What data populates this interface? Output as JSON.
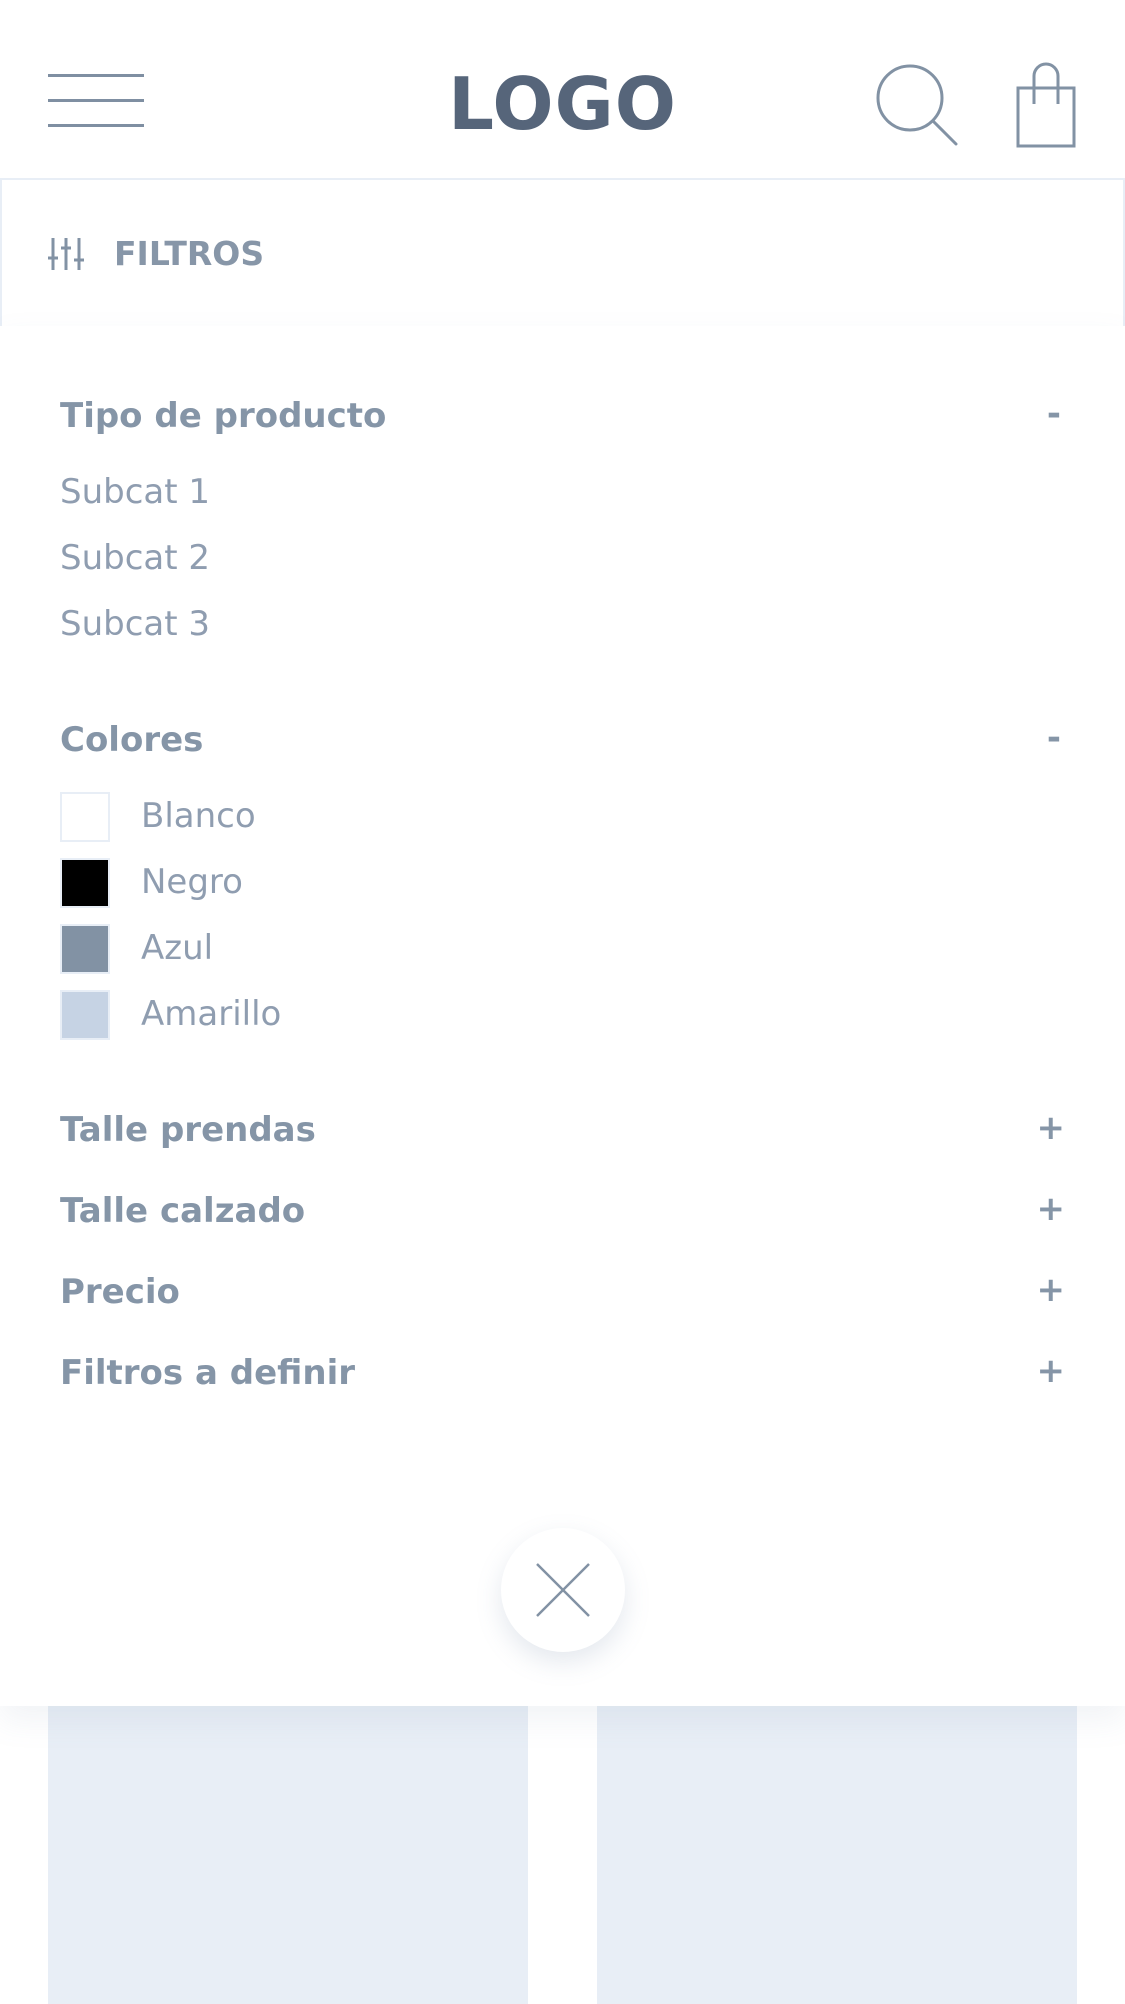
{
  "header": {
    "logo": "LOGO",
    "menu_icon": "hamburger-menu-icon",
    "search_icon": "search-icon",
    "cart_icon": "shopping-bag-icon"
  },
  "filters_bar": {
    "label": "FILTROS",
    "icon": "sliders-icon"
  },
  "filters": {
    "product_type": {
      "title": "Tipo de producto",
      "toggle": "-",
      "items": [
        "Subcat 1",
        "Subcat 2",
        "Subcat 3"
      ]
    },
    "colors": {
      "title": "Colores",
      "toggle": "-",
      "items": [
        {
          "label": "Blanco",
          "color": "#ffffff"
        },
        {
          "label": "Negro",
          "color": "#000000"
        },
        {
          "label": "Azul",
          "color": "#8292a4"
        },
        {
          "label": "Amarillo",
          "color": "#c6d3e4"
        }
      ]
    },
    "collapsed": [
      {
        "title": "Talle prendas",
        "toggle": "+"
      },
      {
        "title": "Talle calzado",
        "toggle": "+"
      },
      {
        "title": "Precio",
        "toggle": "+"
      },
      {
        "title": "Filtros a definir",
        "toggle": "+"
      }
    ]
  },
  "close_icon": "close-icon",
  "theme": {
    "text": "#8595a7",
    "logo": "#56657a",
    "border": "#e8eef6",
    "placeholder": "#e8eef6"
  }
}
